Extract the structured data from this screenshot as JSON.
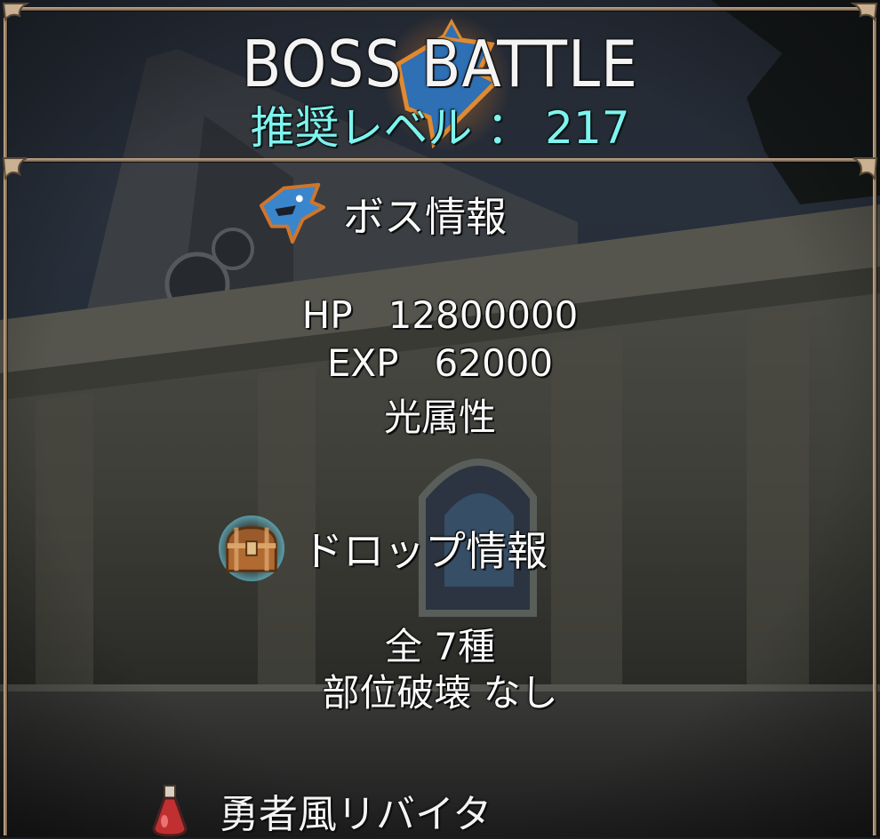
{
  "header": {
    "title": "BOSS BATTLE",
    "recommended_level": "推奨レベル ： 217"
  },
  "boss_info": {
    "heading": "ボス情報",
    "icon": "blue-dragon-head-icon",
    "hp_line": "HP   12800000",
    "exp_line": "EXP   62000",
    "element": "光属性"
  },
  "drop_info": {
    "heading": "ドロップ情報",
    "icon": "treasure-chest-icon",
    "total_kinds": "全 7種",
    "part_break": "部位破壊 なし",
    "items": [
      {
        "name": "勇者風リバイタ",
        "icon": "potion-flask-icon"
      }
    ]
  },
  "colors": {
    "accent_cyan": "#7ff3ee",
    "frame_gold": "#c9b090",
    "text_white": "#fafafa"
  }
}
